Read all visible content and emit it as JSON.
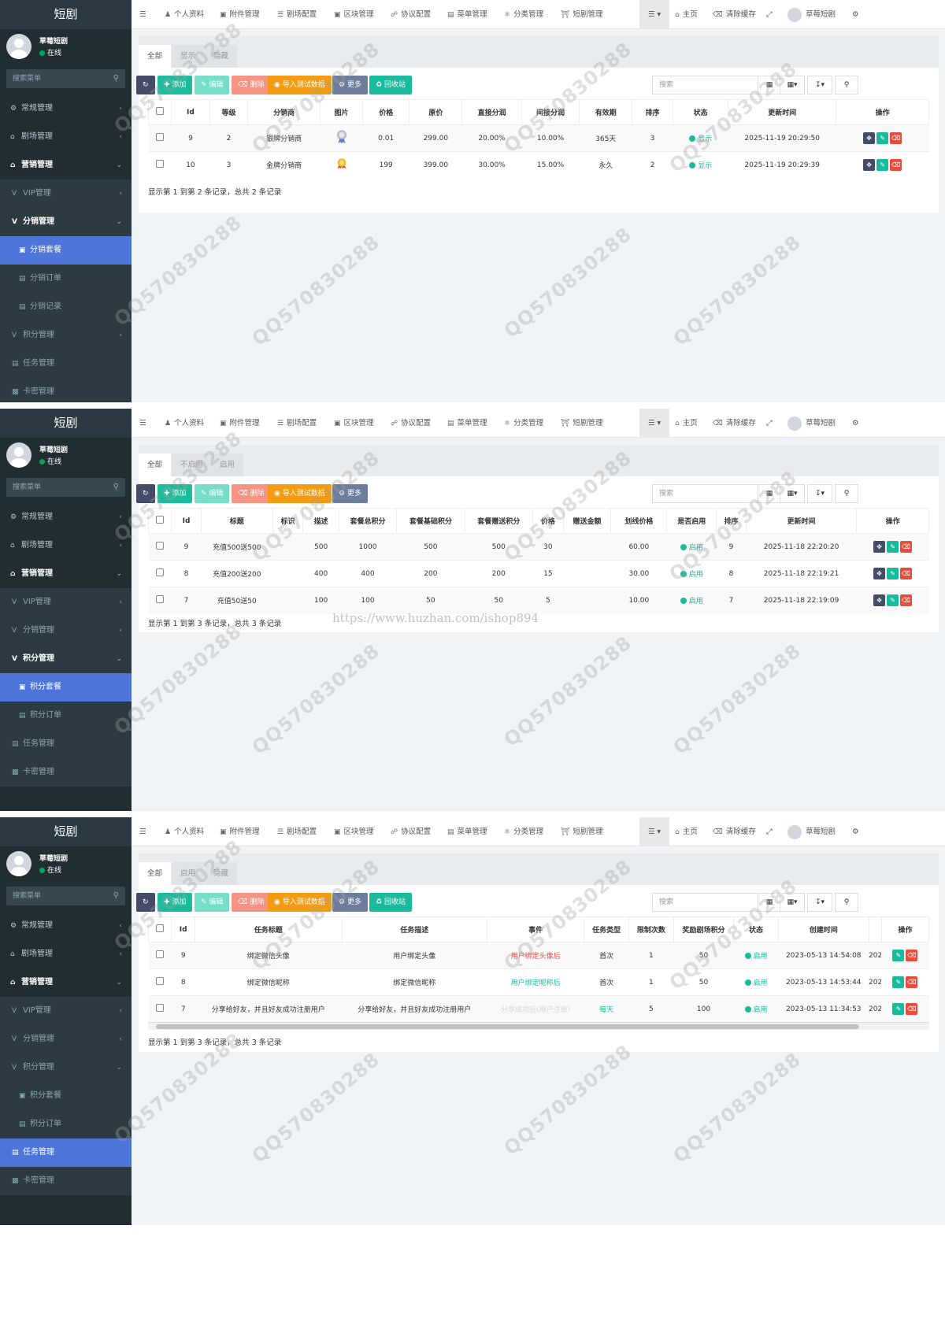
{
  "common": {
    "logo": "短剧",
    "user_name": "草莓短剧",
    "user_status": "在线",
    "search_placeholder": "搜索菜单",
    "nav": [
      "个人资料",
      "附件管理",
      "剧场配置",
      "区块管理",
      "协议配置",
      "菜单管理",
      "分类管理",
      "短剧管理"
    ],
    "nav_right": {
      "home": "主页",
      "clear_cache": "清除缓存",
      "user": "草莓短剧"
    },
    "table_search_placeholder": "搜索",
    "btn": {
      "add": "添加",
      "edit": "编辑",
      "delete": "删除",
      "import": "导入测试数据",
      "more": "更多",
      "recycle": "回收站"
    },
    "op_header": "操作"
  },
  "panel1": {
    "menu": [
      {
        "label": "常规管理"
      },
      {
        "label": "剧场管理"
      },
      {
        "label": "营销管理"
      },
      {
        "label": "VIP管理"
      },
      {
        "label": "分销管理"
      },
      {
        "label": "分销套餐"
      },
      {
        "label": "分销订单"
      },
      {
        "label": "分销记录"
      },
      {
        "label": "积分管理"
      },
      {
        "label": "任务管理"
      },
      {
        "label": "卡密管理"
      }
    ],
    "tabs": [
      "全部",
      "显示",
      "隐藏"
    ],
    "columns": [
      "Id",
      "等级",
      "分销商",
      "图片",
      "价格",
      "原价",
      "直接分润",
      "间接分润",
      "有效期",
      "排序",
      "状态",
      "更新时间",
      "操作"
    ],
    "rows": [
      {
        "id": "9",
        "level": "2",
        "name": "银牌分销商",
        "price": "0.01",
        "orig": "299.00",
        "direct": "20.00%",
        "indirect": "10.00%",
        "valid": "365天",
        "sort": "3",
        "status": "显示",
        "updated": "2025-11-19 20:29:50"
      },
      {
        "id": "10",
        "level": "3",
        "name": "金牌分销商",
        "price": "199",
        "orig": "399.00",
        "direct": "30.00%",
        "indirect": "15.00%",
        "valid": "永久",
        "sort": "2",
        "status": "显示",
        "updated": "2025-11-19 20:29:39"
      }
    ],
    "footer": "显示第 1 到第 2 条记录，总共 2 条记录"
  },
  "panel2": {
    "menu": [
      {
        "label": "常规管理"
      },
      {
        "label": "剧场管理"
      },
      {
        "label": "营销管理"
      },
      {
        "label": "VIP管理"
      },
      {
        "label": "分销管理"
      },
      {
        "label": "积分管理"
      },
      {
        "label": "积分套餐"
      },
      {
        "label": "积分订单"
      },
      {
        "label": "任务管理"
      },
      {
        "label": "卡密管理"
      }
    ],
    "tabs": [
      "全部",
      "不启用",
      "启用"
    ],
    "columns": [
      "Id",
      "标题",
      "标识",
      "描述",
      "套餐总积分",
      "套餐基础积分",
      "套餐赠送积分",
      "价格",
      "赠送金额",
      "划线价格",
      "是否启用",
      "排序",
      "更新时间",
      "操作"
    ],
    "rows": [
      {
        "id": "9",
        "title": "充值500送500",
        "mark": "",
        "desc": "500",
        "total": "1000",
        "base": "500",
        "gift": "500",
        "price": "30",
        "giftamt": "",
        "line": "60.00",
        "enabled": "启用",
        "sort": "9",
        "updated": "2025-11-18 22:20:20"
      },
      {
        "id": "8",
        "title": "充值200送200",
        "mark": "",
        "desc": "400",
        "total": "400",
        "base": "200",
        "gift": "200",
        "price": "15",
        "giftamt": "",
        "line": "30.00",
        "enabled": "启用",
        "sort": "8",
        "updated": "2025-11-18 22:19:21"
      },
      {
        "id": "7",
        "title": "充值50送50",
        "mark": "",
        "desc": "100",
        "total": "100",
        "base": "50",
        "gift": "50",
        "price": "5",
        "giftamt": "",
        "line": "10.00",
        "enabled": "启用",
        "sort": "7",
        "updated": "2025-11-18 22:19:09"
      }
    ],
    "footer": "显示第 1 到第 3 条记录，总共 3 条记录",
    "url_watermark": "https://www.huzhan.com/ishop894"
  },
  "panel3": {
    "menu": [
      {
        "label": "常规管理"
      },
      {
        "label": "剧场管理"
      },
      {
        "label": "营销管理"
      },
      {
        "label": "VIP管理"
      },
      {
        "label": "分销管理"
      },
      {
        "label": "积分管理"
      },
      {
        "label": "积分套餐"
      },
      {
        "label": "积分订单"
      },
      {
        "label": "任务管理"
      },
      {
        "label": "卡密管理"
      }
    ],
    "tabs": [
      "全部",
      "启用",
      "隐藏"
    ],
    "columns": [
      "Id",
      "任务标题",
      "任务描述",
      "事件",
      "任务类型",
      "限制次数",
      "奖励剧场积分",
      "状态",
      "创建时间",
      "操作"
    ],
    "rows": [
      {
        "id": "9",
        "title": "绑定微信头像",
        "desc": "用户绑定头像",
        "event": "用户绑定头像后",
        "type": "首次",
        "limit": "1",
        "reward": "50",
        "status": "启用",
        "created": "2023-05-13 14:54:08",
        "extra": "202"
      },
      {
        "id": "8",
        "title": "绑定微信昵称",
        "desc": "绑定微信昵称",
        "event": "用户绑定昵称后",
        "type": "首次",
        "limit": "1",
        "reward": "50",
        "status": "启用",
        "created": "2023-05-13 14:53:44",
        "extra": "202"
      },
      {
        "id": "7",
        "title": "分享给好友，并且好友成功注册用户",
        "desc": "分享给好友，并且好友成功注册用户",
        "event": "分享成功后(用户注册)",
        "type": "每天",
        "limit": "5",
        "reward": "100",
        "status": "启用",
        "created": "2023-05-13 11:34:53",
        "extra": "202"
      }
    ],
    "footer": "显示第 1 到第 3 条记录，总共 3 条记录"
  },
  "watermark": "QQ570830288",
  "colors": {
    "sidebar": "#222d32",
    "active": "#4e75d9",
    "green": "#18bc9c",
    "red": "#e74c3c",
    "orange": "#f39c12"
  }
}
